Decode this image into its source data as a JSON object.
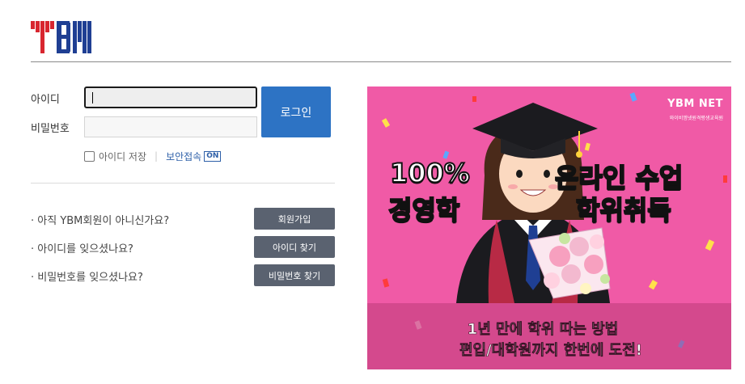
{
  "brand": {
    "logo_text": "YBM",
    "colors": {
      "red": "#d8262f",
      "blue": "#1f3f93",
      "button_blue": "#2d73c4",
      "button_gray": "#5a6270",
      "banner_pink": "#f05aa6"
    }
  },
  "login": {
    "id_label": "아이디",
    "pw_label": "비밀번호",
    "id_value": "",
    "pw_value": "",
    "login_button": "로그인",
    "save_id_label": "아이디 저장",
    "save_id_checked": false,
    "secure_label": "보안접속",
    "secure_badge": "ON"
  },
  "help": [
    {
      "question": "· 아직 YBM회원이 아니신가요?",
      "button": "회원가입"
    },
    {
      "question": "· 아이디를 잊으셨나요?",
      "button": "아이디 찾기"
    },
    {
      "question": "· 비밀번호를 잊으셨나요?",
      "button": "비밀번호 찾기"
    }
  ],
  "banner": {
    "logo": "YBM NET",
    "sub_logo": "와이비엠넷원격평생교육원",
    "headline_1a": "100%",
    "headline_1b": "온라인 수업",
    "headline_2a": "경영학",
    "headline_2b": "학위취득",
    "strip_line_1": "1년 만에 학위 따는 방법",
    "strip_line_2": "편입/대학원까지 한번에 도전!"
  }
}
